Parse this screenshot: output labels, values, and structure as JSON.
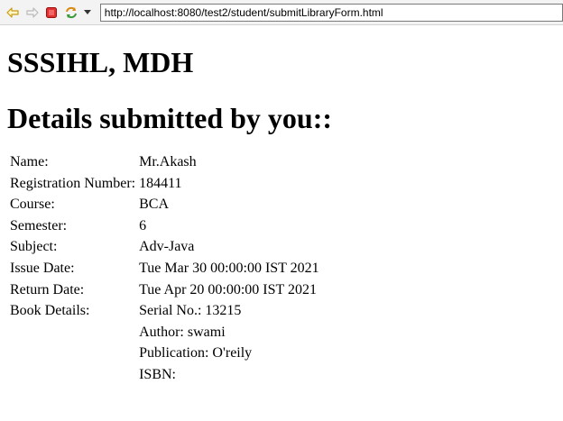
{
  "browser": {
    "url": "http://localhost:8080/test2/student/submitLibraryForm.html",
    "icons": [
      "back-icon",
      "forward-icon",
      "stop-icon",
      "refresh-icon",
      "dropdown-arrow-icon"
    ]
  },
  "page": {
    "institution": "SSSIHL, MDH",
    "heading": "Details submitted by you::",
    "fields": [
      {
        "label": "Name:",
        "value": "Mr.Akash"
      },
      {
        "label": "Registration Number:",
        "value": "184411"
      },
      {
        "label": "Course:",
        "value": "BCA"
      },
      {
        "label": "Semester:",
        "value": "6"
      },
      {
        "label": "Subject:",
        "value": "Adv-Java"
      },
      {
        "label": "Issue Date:",
        "value": "Tue Mar 30 00:00:00 IST 2021"
      },
      {
        "label": "Return Date:",
        "value": "Tue Apr 20 00:00:00 IST 2021"
      }
    ],
    "book": {
      "label": "Book Details:",
      "lines": [
        "Serial No.: 13215",
        "Author: swami",
        "Publication: O'reily",
        "ISBN:"
      ]
    }
  }
}
